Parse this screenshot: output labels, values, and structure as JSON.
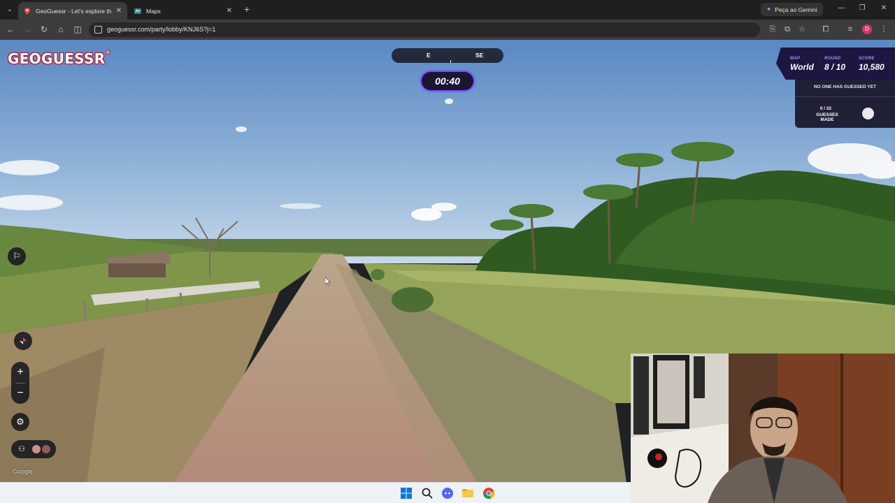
{
  "browser": {
    "tabs": [
      {
        "title": "GeoGuessr - Let's explore the w",
        "active": true,
        "favicon": "geoguessr-pin-icon"
      },
      {
        "title": "Maps",
        "active": false,
        "favicon": "maps-icon"
      }
    ],
    "gemini_label": "Peça ao Gemini",
    "url": "geoguessr.com/party/lobby/KNJ6S?j=1",
    "profile_initial": "D"
  },
  "game": {
    "logo": "GEOGUESSR",
    "compass": {
      "left": "E",
      "right": "SE"
    },
    "timer": "00:40",
    "status": {
      "map_label": "MAP",
      "map_value": "World",
      "round_label": "ROUND",
      "round_value": "8 / 10",
      "score_label": "SCORE",
      "score_value": "10,580"
    },
    "no_guess_text": "NO ONE HAS GUESSED YET",
    "guesses_count": "0 / 22",
    "guesses_label": "GUESSES MADE",
    "attribution": "Google"
  },
  "colors": {
    "accent_purple": "#7b4bff",
    "panel_dark": "#1c1640",
    "logo_red": "#c01a2b"
  }
}
